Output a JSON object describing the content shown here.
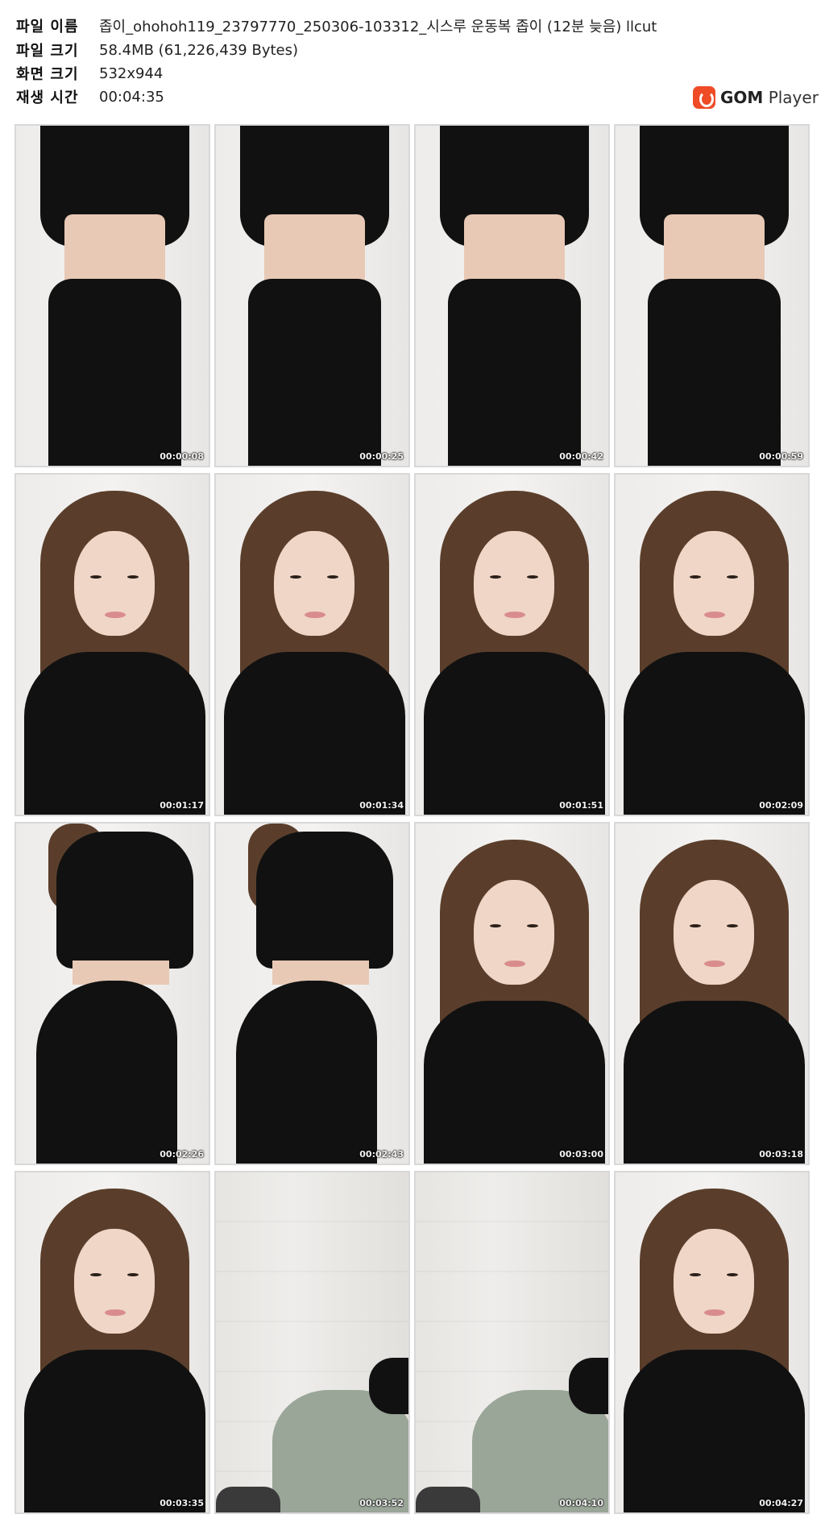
{
  "file_info": {
    "name_label": "파일 이름",
    "name_value": "좁이_ohohoh119_23797770_250306-103312_시스루 운동복 좁이 (12분 늦음) llcut",
    "size_label": "파일 크기",
    "size_value": "58.4MB (61,226,439 Bytes)",
    "resolution_label": "화면 크기",
    "resolution_value": "532x944",
    "duration_label": "재생 시간",
    "duration_value": "00:04:35"
  },
  "logo": {
    "brand": "GOM",
    "product": "Player",
    "icon": "gom-logo-icon",
    "color": "#ef4b26"
  },
  "thumbnails": [
    {
      "timestamp": "00:00:08",
      "scene": "torso"
    },
    {
      "timestamp": "00:00:25",
      "scene": "torso"
    },
    {
      "timestamp": "00:00:42",
      "scene": "torso"
    },
    {
      "timestamp": "00:00:59",
      "scene": "torso"
    },
    {
      "timestamp": "00:01:17",
      "scene": "face"
    },
    {
      "timestamp": "00:01:34",
      "scene": "face"
    },
    {
      "timestamp": "00:01:51",
      "scene": "face"
    },
    {
      "timestamp": "00:02:09",
      "scene": "face"
    },
    {
      "timestamp": "00:02:26",
      "scene": "back"
    },
    {
      "timestamp": "00:02:43",
      "scene": "back"
    },
    {
      "timestamp": "00:03:00",
      "scene": "face"
    },
    {
      "timestamp": "00:03:18",
      "scene": "face"
    },
    {
      "timestamp": "00:03:35",
      "scene": "face"
    },
    {
      "timestamp": "00:03:52",
      "scene": "empty"
    },
    {
      "timestamp": "00:04:10",
      "scene": "empty"
    },
    {
      "timestamp": "00:04:27",
      "scene": "face"
    }
  ]
}
